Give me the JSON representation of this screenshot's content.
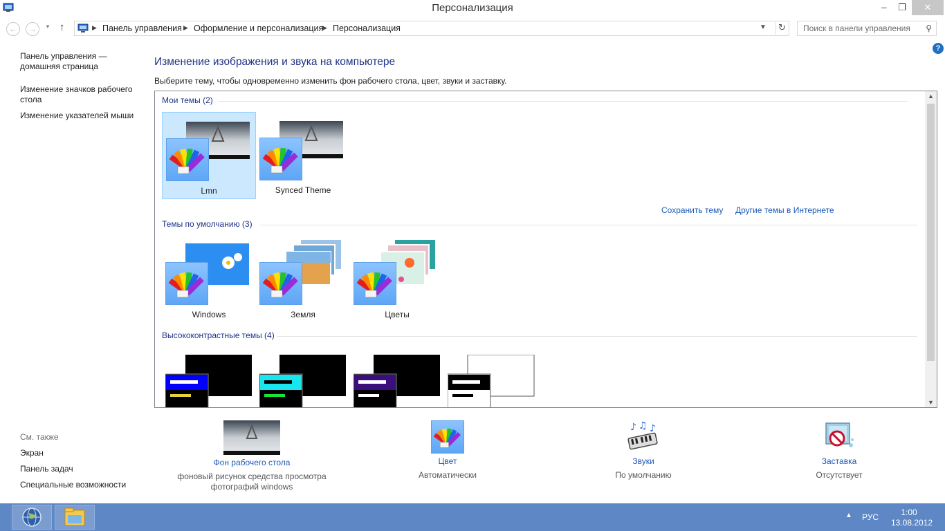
{
  "window": {
    "title": "Персонализация",
    "minimize_glyph": "–",
    "maximize_glyph": "❐",
    "close_glyph": "✕"
  },
  "address_bar": {
    "crumbs": [
      "Панель управления",
      "Оформление и персонализация",
      "Персонализация"
    ],
    "search_placeholder": "Поиск в панели управления"
  },
  "left_pane": {
    "links": [
      "Панель управления — домашняя страница",
      "Изменение значков рабочего стола",
      "Изменение указателей мыши"
    ],
    "see_also_title": "См. также",
    "see_also": [
      "Экран",
      "Панель задач",
      "Специальные возможности"
    ]
  },
  "main": {
    "heading": "Изменение изображения и звука на компьютере",
    "subheading": "Выберите тему, чтобы одновременно изменить фон рабочего стола, цвет, звуки и заставку.",
    "save_theme_link": "Сохранить тему",
    "more_themes_link": "Другие темы в Интернете",
    "groups": [
      {
        "title": "Мои темы (2)",
        "themes": [
          "Lmn",
          "Synced Theme"
        ],
        "selected": "Lmn"
      },
      {
        "title": "Темы по умолчанию (3)",
        "themes": [
          "Windows",
          "Земля",
          "Цветы"
        ]
      },
      {
        "title": "Высококонтрастные темы (4)",
        "themes": [
          "",
          "",
          "",
          ""
        ]
      }
    ]
  },
  "settings": [
    {
      "label": "Фон рабочего стола",
      "desc": "фоновый рисунок средства просмотра фотографий windows",
      "icon": "desktop-background-icon"
    },
    {
      "label": "Цвет",
      "desc": "Автоматически",
      "icon": "color-palette-icon"
    },
    {
      "label": "Звуки",
      "desc": "По умолчанию",
      "icon": "sounds-icon"
    },
    {
      "label": "Заставка",
      "desc": "Отсутствует",
      "icon": "screensaver-icon"
    }
  ],
  "taskbar": {
    "lang": "РУС",
    "time": "1:00",
    "date": "13.08.2012"
  },
  "colors": {
    "heading": "#1e3287",
    "link": "#1d5ab7",
    "selection": "#cce8ff",
    "taskbar": "#5d87c5"
  }
}
